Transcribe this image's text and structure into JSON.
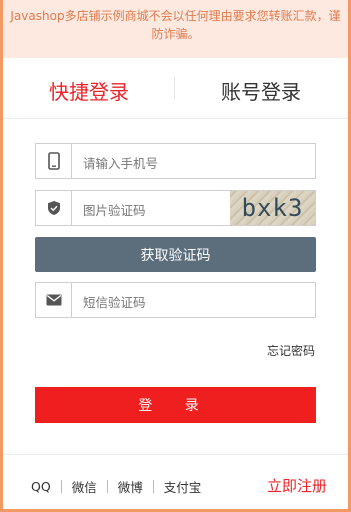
{
  "notice": {
    "text": "Javashop多店铺示例商城不会以任何理由要求您转账汇款，谨防诈骗。"
  },
  "tabs": {
    "quick": "快捷登录",
    "account": "账号登录"
  },
  "form": {
    "phone_placeholder": "请输入手机号",
    "captcha_placeholder": "图片验证码",
    "captcha_image_text": "bxk3",
    "get_code_label": "获取验证码",
    "sms_placeholder": "短信验证码",
    "forgot_label": "忘记密码",
    "login_label": "登 录"
  },
  "footer": {
    "oauth": [
      "QQ",
      "微信",
      "微博",
      "支付宝"
    ],
    "register_label": "立即注册"
  },
  "colors": {
    "accent": "#e8262c",
    "button_gray": "#5c6e7c",
    "notice_bg": "#fde9df"
  }
}
